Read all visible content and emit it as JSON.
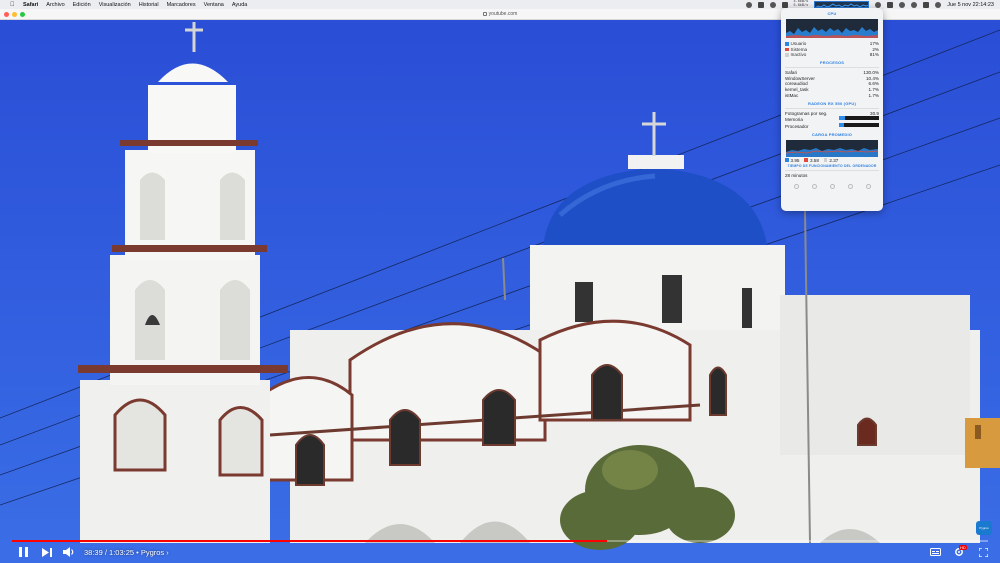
{
  "menubar": {
    "app": "Safari",
    "items": [
      "Archivo",
      "Edición",
      "Visualización",
      "Historial",
      "Marcadores",
      "Ventana",
      "Ayuda"
    ],
    "net_up": "4.6kB/s",
    "net_down": "5.6kB/s",
    "clock": "Jue 5 nov  22:14:23",
    "icons": [
      "camera-icon",
      "bolt-icon",
      "eye-icon",
      "sliders-icon",
      "network-icon",
      "cpu-graph-icon",
      "wifi-icon",
      "battery-icon",
      "volume-icon",
      "search-icon",
      "control-center-icon",
      "siri-icon"
    ]
  },
  "toolbar": {
    "url": "youtube.com",
    "traffic_colors": [
      "#ff5f57",
      "#febc2e",
      "#28c840"
    ]
  },
  "player": {
    "time": "38:39 / 1:03:25 • Pygros ›",
    "progress": 0.61,
    "progress_color": "#ff0000",
    "channel_badge": "Pygros"
  },
  "stats": {
    "cpu_header": "CPU",
    "cpu_rows": [
      {
        "label": "Usuario",
        "value": "17%",
        "color": "#2a86e0"
      },
      {
        "label": "Sistema",
        "value": "2%",
        "color": "#e04a3a"
      },
      {
        "label": "Inactivo",
        "value": "81%",
        "color": "#cfcfcf"
      }
    ],
    "proc_header": "PROCESOS",
    "processes": [
      {
        "name": "Safari",
        "value": "130.0%"
      },
      {
        "name": "WindowServer",
        "value": "10.4%"
      },
      {
        "name": "coreaudiod",
        "value": "6.6%"
      },
      {
        "name": "kernel_task",
        "value": "1.7%"
      },
      {
        "name": "istMac",
        "value": "1.7%"
      }
    ],
    "gpu_header": "RADEON RX 550 (GPU)",
    "gpu_rows": [
      {
        "label": "Fotogramas por seg.",
        "value": "30.9"
      },
      {
        "label": "Memoria",
        "fraction": 0.14
      },
      {
        "label": "Procesador",
        "fraction": 0.12
      }
    ],
    "load_header": "CARGA PROMEDIO",
    "load_values": [
      "3.95",
      "3.58",
      "2.37"
    ],
    "load_colors": [
      "#2a86e0",
      "#e04a3a",
      "#cfcfcf"
    ],
    "uptime_header": "TIEMPO DE FUNCIONAMIENTO DEL ORDENADOR",
    "uptime": "28 minutos"
  }
}
